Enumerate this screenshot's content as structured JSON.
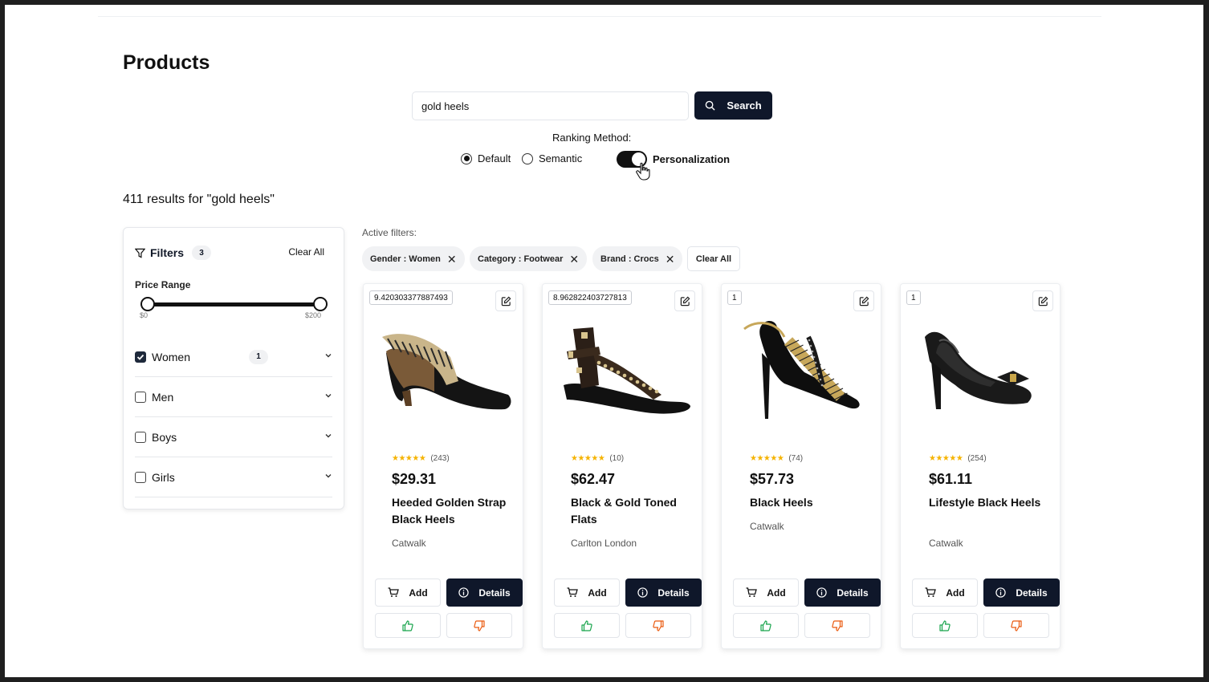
{
  "page": {
    "title": "Products"
  },
  "search": {
    "value": "gold heels",
    "placeholder": "",
    "button_label": "Search"
  },
  "ranking": {
    "label": "Ranking Method:",
    "options": [
      {
        "label": "Default",
        "selected": true
      },
      {
        "label": "Semantic",
        "selected": false
      }
    ],
    "toggle": {
      "label": "Personalization",
      "on": true
    }
  },
  "results": {
    "count_text": "411 results for \"gold heels\""
  },
  "filters": {
    "title": "Filters",
    "count": "3",
    "clear_all": "Clear All",
    "price_range": {
      "label": "Price Range",
      "min_label": "$0",
      "max_label": "$200"
    },
    "facets": [
      {
        "label": "Women",
        "checked": true,
        "count": "1"
      },
      {
        "label": "Men",
        "checked": false
      },
      {
        "label": "Boys",
        "checked": false
      },
      {
        "label": "Girls",
        "checked": false
      }
    ]
  },
  "active_filters": {
    "label": "Active filters:",
    "chips": [
      "Gender : Women",
      "Category : Footwear",
      "Brand : Crocs"
    ],
    "clear_all": "Clear All"
  },
  "products": [
    {
      "score": "9.420303377887493",
      "rating": 4.5,
      "reviews": "(243)",
      "price": "$29.31",
      "name": "Heeded Golden Strap Black Heels",
      "brand": "Catwalk",
      "image": "wedge-thong-sandal"
    },
    {
      "score": "8.962822403727813",
      "rating": 4.5,
      "reviews": "(10)",
      "price": "$62.47",
      "name": "Black & Gold Toned Flats",
      "brand": "Carlton London",
      "image": "studded-strap-flat"
    },
    {
      "score": "1",
      "rating": 4.5,
      "reviews": "(74)",
      "price": "$57.73",
      "name": "Black Heels",
      "brand": "Catwalk",
      "image": "slingback-heel"
    },
    {
      "score": "1",
      "rating": 4.5,
      "reviews": "(254)",
      "price": "$61.11",
      "name": "Lifestyle Black Heels",
      "brand": "Catwalk",
      "image": "patent-bow-pump"
    }
  ],
  "card_actions": {
    "add_label": "Add",
    "details_label": "Details"
  },
  "icons": {
    "search": "search-icon",
    "filter": "filter-icon",
    "edit": "edit-icon",
    "cart": "cart-icon",
    "info": "info-icon",
    "thumbs_up": "thumbs-up-icon",
    "thumbs_down": "thumbs-down-icon",
    "chevron": "chevron-down-icon",
    "close": "close-icon"
  },
  "colors": {
    "primary": "#0f172a",
    "star": "#f5b301",
    "thumb_up": "#16a34a",
    "thumb_down": "#ea580c"
  }
}
